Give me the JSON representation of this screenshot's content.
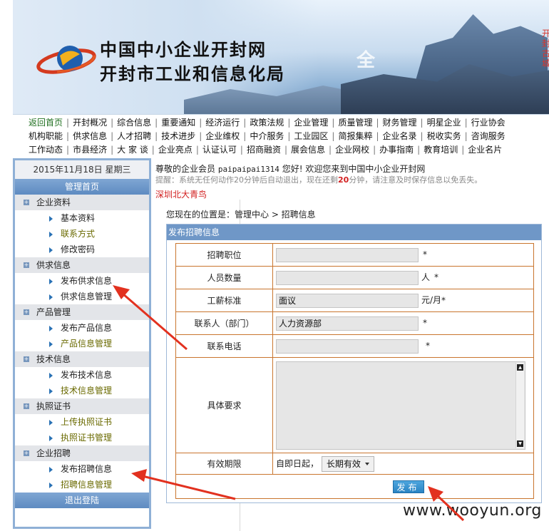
{
  "banner": {
    "title_line1": "中国中小企业开封网",
    "title_line2": "开封市工业和信息化局",
    "overlay_char": "全",
    "side_text": "开封古城"
  },
  "nav": {
    "rows": [
      [
        "返回首页",
        "开封概况",
        "综合信息",
        "重要通知",
        "经济运行",
        "政策法规",
        "企业管理",
        "质量管理",
        "财务管理",
        "明星企业",
        "行业协会"
      ],
      [
        "机构职能",
        "供求信息",
        "人才招聘",
        "技术进步",
        "企业维权",
        "中介服务",
        "工业园区",
        "简报集粹",
        "企业名录",
        "税收实务",
        "咨询服务"
      ],
      [
        "工作动态",
        "市县经济",
        "大 家 谈",
        "企业亮点",
        "认证认可",
        "招商融资",
        "展会信息",
        "企业网校",
        "办事指南",
        "教育培训",
        "企业名片"
      ]
    ]
  },
  "sidebar": {
    "date": "2015年11月18日  星期三",
    "home": "管理首页",
    "groups": [
      {
        "title": "企业资料",
        "items": [
          {
            "label": "基本资料",
            "style": "normal"
          },
          {
            "label": "联系方式",
            "style": "olive"
          },
          {
            "label": "修改密码",
            "style": "normal"
          }
        ]
      },
      {
        "title": "供求信息",
        "items": [
          {
            "label": "发布供求信息",
            "style": "normal"
          },
          {
            "label": "供求信息管理",
            "style": "normal"
          }
        ]
      },
      {
        "title": "产品管理",
        "items": [
          {
            "label": "发布产品信息",
            "style": "normal"
          },
          {
            "label": "产品信息管理",
            "style": "olive"
          }
        ]
      },
      {
        "title": "技术信息",
        "items": [
          {
            "label": "发布技术信息",
            "style": "normal"
          },
          {
            "label": "技术信息管理",
            "style": "olive"
          }
        ]
      },
      {
        "title": "执照证书",
        "items": [
          {
            "label": "上传执照证书",
            "style": "olive"
          },
          {
            "label": "执照证书管理",
            "style": "olive"
          }
        ]
      },
      {
        "title": "企业招聘",
        "items": [
          {
            "label": "发布招聘信息",
            "style": "normal"
          },
          {
            "label": "招聘信息管理",
            "style": "olive"
          }
        ]
      }
    ],
    "logout": "退出登陆"
  },
  "header": {
    "welcome_prefix": "尊敬的企业会员 ",
    "username": "paipaipai1314",
    "welcome_suffix": " 您好! 欢迎您来到中国中小企业开封网",
    "remind_prefix": "提醒：系统无任何动作20分钟后自动退出，现在还剩",
    "remind_minutes": "20",
    "remind_suffix": "分钟，请注意及时保存信息以免丢失。",
    "scroll_ad": "深圳北大青鸟"
  },
  "location": "您现在的位置是：管理中心 > 招聘信息",
  "form": {
    "panel_title": "发布招聘信息",
    "fields": {
      "position": {
        "label": "招聘职位",
        "value": "",
        "star": "*"
      },
      "count": {
        "label": "人员数量",
        "value": "",
        "unit": "人",
        "star": "*"
      },
      "salary": {
        "label": "工薪标准",
        "value": "面议",
        "unit": "元/月",
        "star": "*"
      },
      "contact": {
        "label": "联系人（部门）",
        "value": "人力资源部",
        "star": "*"
      },
      "phone": {
        "label": "联系电话",
        "value": "",
        "star": "*"
      },
      "requirements": {
        "label": "具体要求",
        "value": ""
      },
      "validity": {
        "label": "有效期限",
        "prefix": "自即日起，",
        "selected": "长期有效"
      }
    },
    "submit_label": "发布"
  },
  "watermark": "www.wooyun.org"
}
